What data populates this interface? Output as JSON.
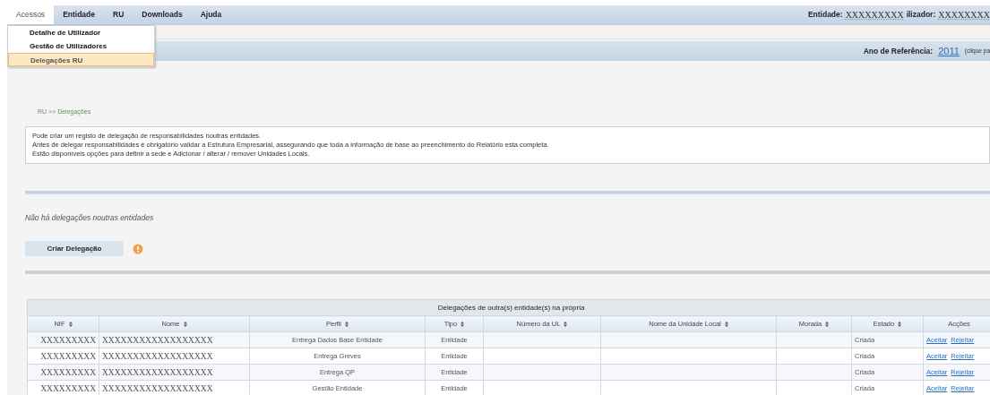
{
  "menu_bar": {
    "items": [
      {
        "label": "Acessos",
        "selected": true
      },
      {
        "label": "Entidade",
        "selected": false
      },
      {
        "label": "RU",
        "selected": false
      },
      {
        "label": "Downloads",
        "selected": false
      },
      {
        "label": "Ajuda",
        "selected": false
      }
    ],
    "user_info": [
      {
        "kind": "label",
        "text": "Entidade:"
      },
      {
        "kind": "value",
        "text": "XXXXXXXXX"
      },
      {
        "kind": "label",
        "text": "ilizador:"
      },
      {
        "kind": "value",
        "text": "XXXXXXXX"
      }
    ]
  },
  "dropdown": {
    "items": [
      {
        "label": "Detalhe de Utilizador",
        "selected": false
      },
      {
        "label": "Gestão de Utilizadores",
        "selected": false
      },
      {
        "label": "Delegações RU",
        "selected": true
      }
    ]
  },
  "reference_bar": {
    "label": "Ano de Referência:",
    "year": "2011",
    "hint": "(clique pa"
  },
  "breadcrumb": "RU >> Delegações",
  "info_lines": [
    "Pode criar um registo de delegação de responsabilidades noutras entidades.",
    "Antes de delegar responsabilidades é obrigatório validar a Estrutura Empresarial, assegurando que toda a informação de base ao preenchimento do Relatório esta completa.",
    "Estão disponíveis opções para definir a sede e Adicionar / alterar / remover Unidades Locais."
  ],
  "empty_message": "Não há delegações noutras entidades",
  "create_button": "Criar Delegação",
  "table": {
    "title": "Delegações de outra(s) entidade(s) na própria",
    "columns": [
      {
        "label": "NIF",
        "sortable": true
      },
      {
        "label": "Nome",
        "sortable": true
      },
      {
        "label": "Perfil",
        "sortable": true
      },
      {
        "label": "Tipo",
        "sortable": true
      },
      {
        "label": "Número da UL",
        "sortable": true
      },
      {
        "label": "Nome da Unidade Local",
        "sortable": true
      },
      {
        "label": "Morada",
        "sortable": true
      },
      {
        "label": "Estado",
        "sortable": true
      },
      {
        "label": "Acções",
        "sortable": false
      }
    ],
    "rows": [
      {
        "nif": "XXXXXXXXX",
        "nome": "XXXXXXXXXXXXXXXXXX",
        "perfil": "Entrega Dados Base Entidade",
        "tipo": "Entidade",
        "estado": "Criada",
        "accoes": [
          "Aceitar",
          "Rejeitar"
        ]
      },
      {
        "nif": "XXXXXXXXX",
        "nome": "XXXXXXXXXXXXXXXXXX",
        "perfil": "Entrega Greves",
        "tipo": "Entidade",
        "estado": "Criada",
        "accoes": [
          "Aceitar",
          "Rejeitar"
        ]
      },
      {
        "nif": "XXXXXXXXX",
        "nome": "XXXXXXXXXXXXXXXXXX",
        "perfil": "Entrega QP",
        "tipo": "Entidade",
        "estado": "Criada",
        "accoes": [
          "Aceitar",
          "Rejeitar"
        ]
      },
      {
        "nif": "XXXXXXXXX",
        "nome": "XXXXXXXXXXXXXXXXXX",
        "perfil": "Gestão Entidade",
        "tipo": "Entidade",
        "estado": "Criada",
        "accoes": [
          "Aceitar",
          "Rejeitar"
        ]
      }
    ]
  }
}
